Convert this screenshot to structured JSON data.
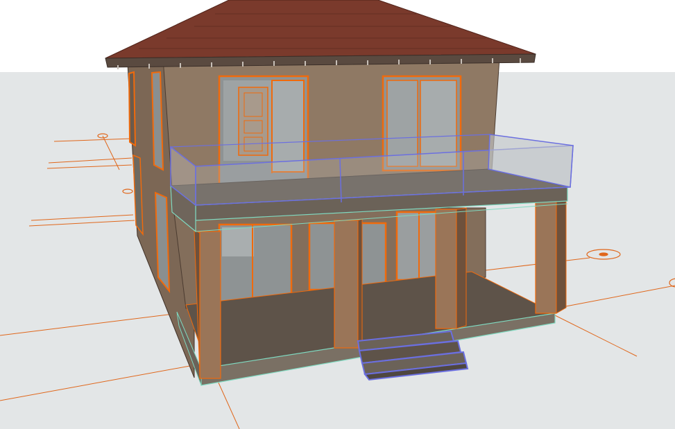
{
  "viewport": {
    "name": "3d-model-view",
    "colors": {
      "sky": "#ffffff",
      "ground": "#e3e6e7",
      "wall": "#8f7964",
      "wall_dark": "#6b5747",
      "roof": "#7a3a2c",
      "roof_dark": "#4f2219",
      "slab": "#5e5349",
      "slab_edge": "#7a7064",
      "column": "#9a7558",
      "column_side": "#6e513c",
      "glass": "#9a9e9f",
      "glass_light": "#c2c7c9",
      "selection_orange": "#f06a0c",
      "selection_blue": "#6b6fe0",
      "edge_cyan": "#7fd9c0",
      "gridline": "#e0661a"
    },
    "elements": [
      "roof",
      "upper-walls",
      "upper-windows",
      "balcony-slab",
      "glass-railing",
      "porch-columns",
      "ground-floor-windows",
      "porch-slab",
      "entry-stairs",
      "grid-lines"
    ]
  }
}
